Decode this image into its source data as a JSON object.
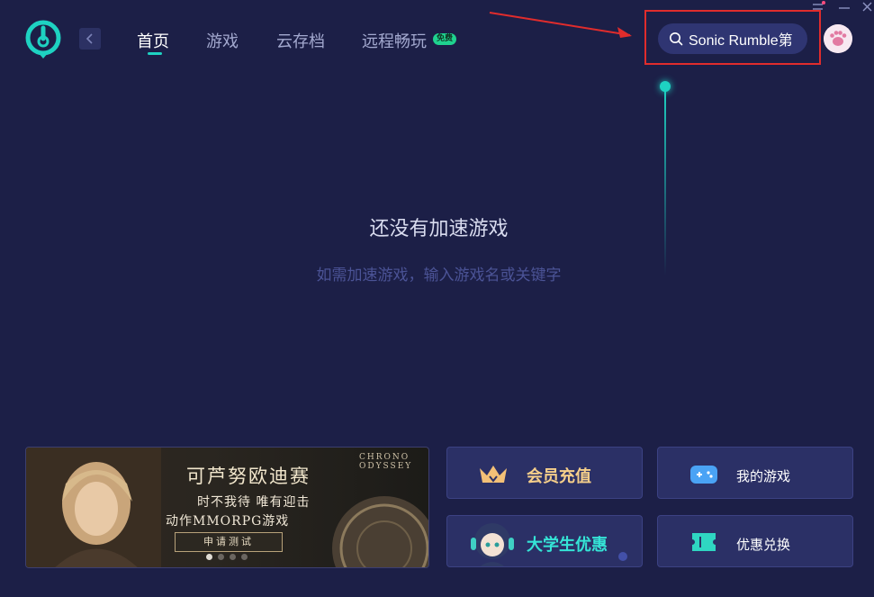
{
  "header": {
    "nav": [
      {
        "label": "首页",
        "active": true
      },
      {
        "label": "游戏",
        "active": false
      },
      {
        "label": "云存档",
        "active": false
      },
      {
        "label": "远程畅玩",
        "active": false
      }
    ],
    "free_badge": "免费",
    "search": {
      "value": "Sonic Rumble第"
    },
    "icons": {
      "logo": "app-logo-icon",
      "back": "chevron-left-icon",
      "search": "search-icon",
      "avatar": "cat-paw-avatar",
      "menu": "menu-icon",
      "minimize": "minimize-icon",
      "close": "close-icon"
    }
  },
  "empty_state": {
    "title": "还没有加速游戏",
    "subtitle": "如需加速游戏，输入游戏名或关键字"
  },
  "banner": {
    "title": "可芦努欧迪赛",
    "line1": "时不我待 唯有迎击",
    "line2": "动作MMORPG游戏",
    "button": "申请测试",
    "logo_line1": "CHRONO",
    "logo_line2": "ODYSSEY",
    "slide_count": 4,
    "active_slide": 1
  },
  "cards": {
    "vip": "会员充值",
    "my_games": "我的游戏",
    "student": "大学生优惠",
    "redeem": "优惠兑换"
  },
  "colors": {
    "background": "#1c1f47",
    "accent": "#1ed2c2",
    "annotation_red": "#e02c2c",
    "gold": "#f6cf8a"
  }
}
